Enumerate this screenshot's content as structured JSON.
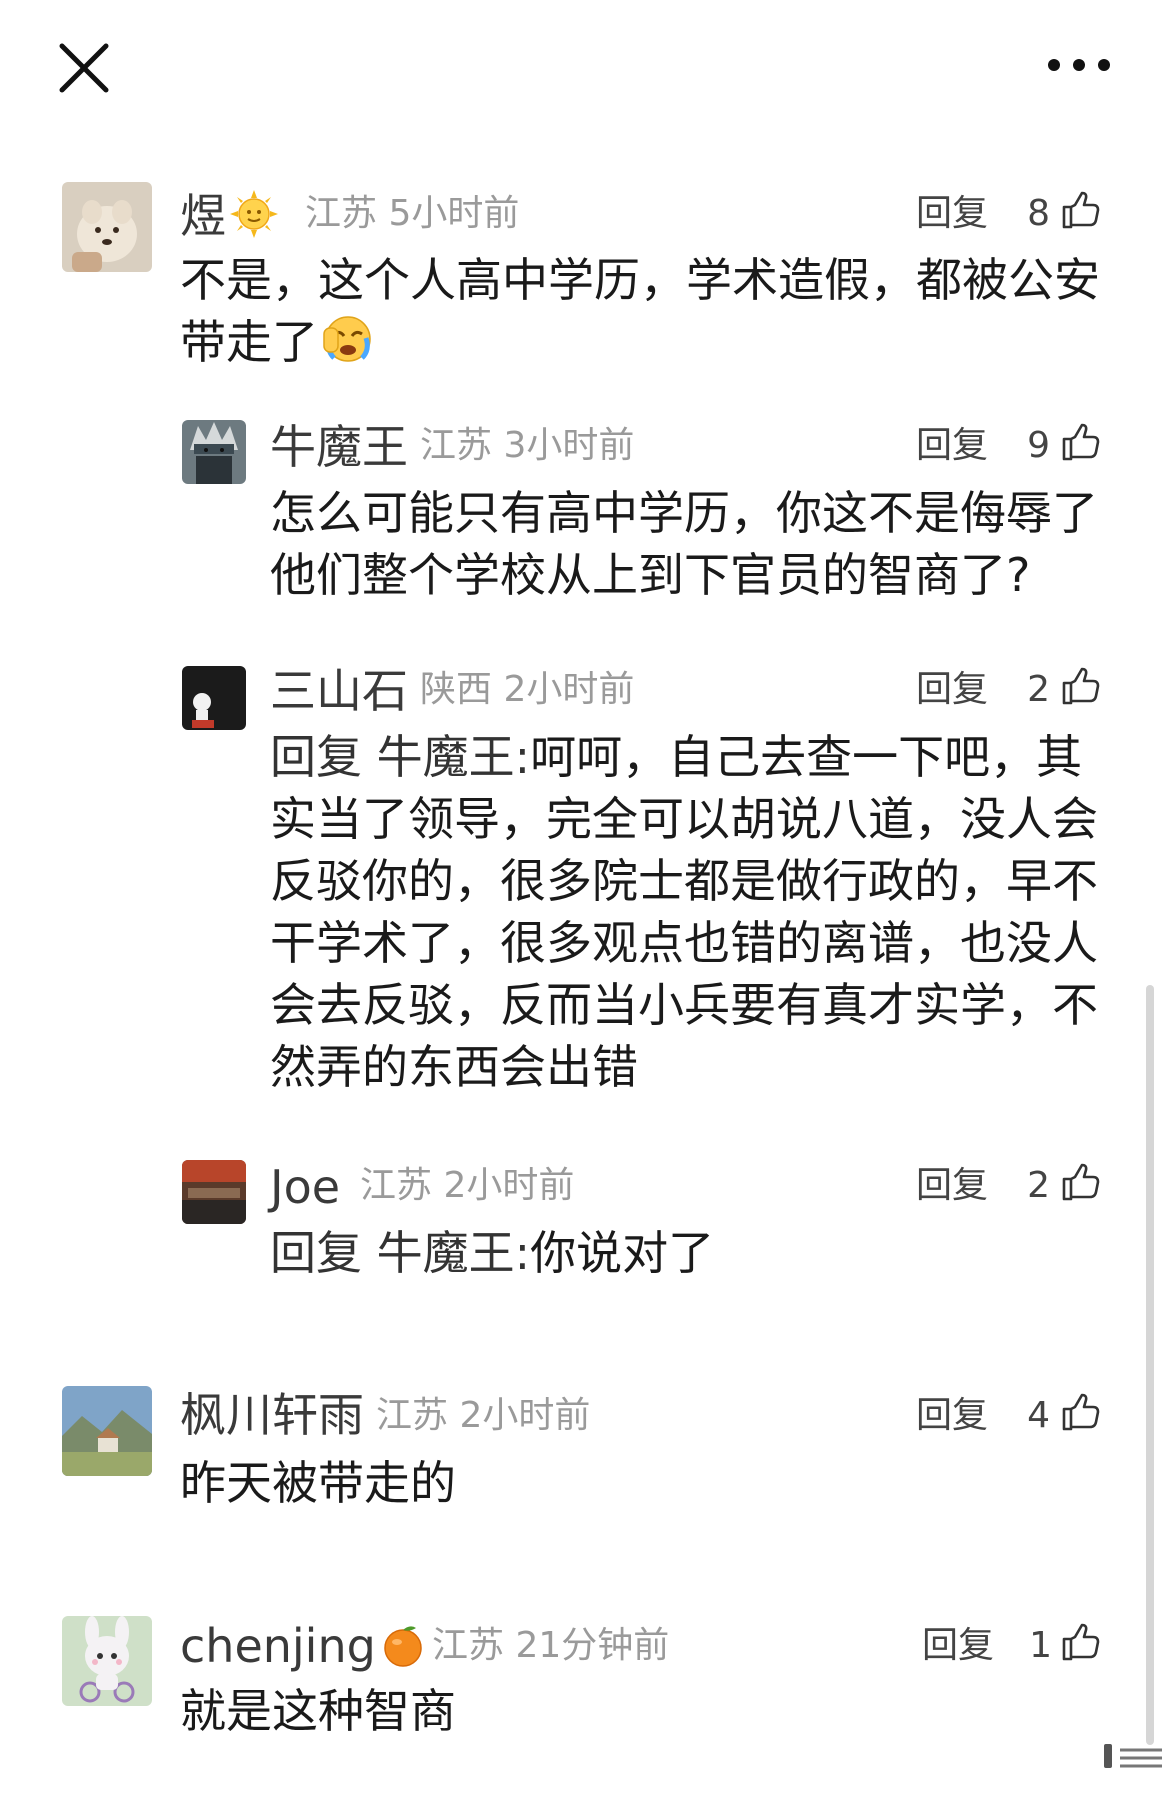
{
  "topbar": {
    "close_icon": "close-icon",
    "more_icon": "more-horizontal-icon"
  },
  "comments": [
    {
      "name": "煜",
      "name_emoji": "sun-face-emoji",
      "location": "江苏",
      "time": "5小时前",
      "reply_label": "回复",
      "likes": "8",
      "text_lines": [
        "不是，这个人高中学历，学术造假，都被公安",
        "带走了"
      ],
      "text_emoji": "crying-face-emoji"
    },
    {
      "name": "牛魔王",
      "location": "江苏",
      "time": "3小时前",
      "reply_label": "回复",
      "likes": "9",
      "text_lines": [
        "怎么可能只有高中学历，你这不是侮辱了",
        "他们整个学校从上到下官员的智商了?"
      ]
    },
    {
      "name": "三山石",
      "location": "陕西",
      "time": "2小时前",
      "reply_label": "回复",
      "likes": "2",
      "reply_prefix": "回复 牛魔王:",
      "text_lines": [
        "呵呵，自己去查一下吧，其",
        "实当了领导，完全可以胡说八道，没人会",
        "反驳你的，很多院士都是做行政的，早不",
        "干学术了，很多观点也错的离谱，也没人",
        "会去反驳，反而当小兵要有真才实学，不",
        "然弄的东西会出错"
      ]
    },
    {
      "name": "Joe",
      "location": "江苏",
      "time": "2小时前",
      "reply_label": "回复",
      "likes": "2",
      "reply_prefix": "回复 牛魔王:",
      "text_lines": [
        "你说对了"
      ]
    },
    {
      "name": "枫川轩雨",
      "location": "江苏",
      "time": "2小时前",
      "reply_label": "回复",
      "likes": "4",
      "text_lines": [
        "昨天被带走的"
      ]
    },
    {
      "name": "chenjing",
      "name_emoji": "tangerine-emoji",
      "location": "江苏",
      "time": "21分钟前",
      "reply_label": "回复",
      "likes": "1",
      "text_lines": [
        "就是这种智商"
      ]
    }
  ]
}
